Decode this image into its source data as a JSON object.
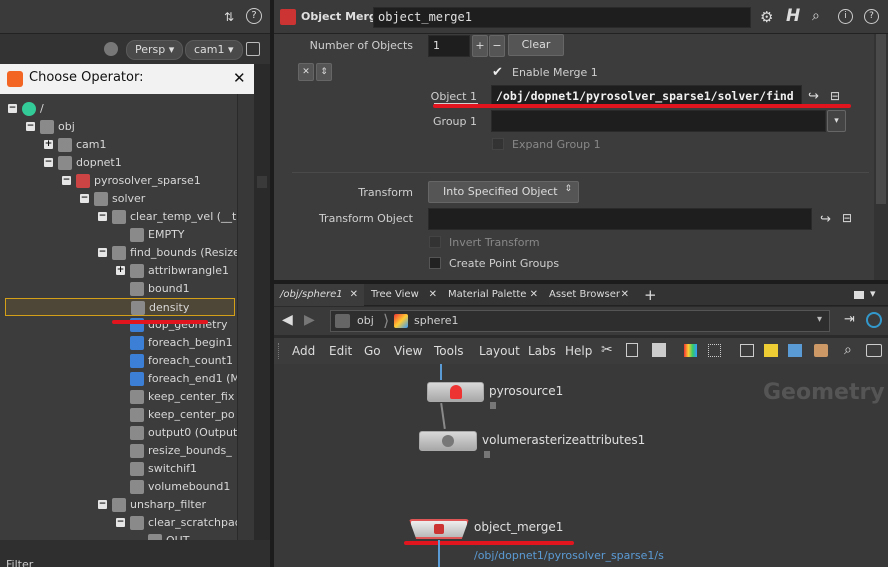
{
  "left_panel": {
    "viewport": {
      "persp_label": "Persp",
      "cam_label": "cam1"
    },
    "chooser_title": "Choose Operator:",
    "close_glyph": "✕",
    "filter_label": "Filter",
    "tree": [
      {
        "label": "/",
        "level": 0,
        "toggle": "−"
      },
      {
        "label": "obj",
        "level": 1,
        "toggle": "−"
      },
      {
        "label": "cam1",
        "level": 2,
        "toggle": "+"
      },
      {
        "label": "dopnet1",
        "level": 2,
        "toggle": "−"
      },
      {
        "label": "pyrosolver_sparse1",
        "level": 3,
        "toggle": "−"
      },
      {
        "label": "solver",
        "level": 4,
        "toggle": "−"
      },
      {
        "label": "clear_temp_vel (__t",
        "level": 5,
        "toggle": "−"
      },
      {
        "label": "EMPTY",
        "level": 6,
        "toggle": ""
      },
      {
        "label": "find_bounds (Resize",
        "level": 5,
        "toggle": "−"
      },
      {
        "label": "attribwrangle1",
        "level": 6,
        "toggle": "+"
      },
      {
        "label": "bound1",
        "level": 6,
        "toggle": ""
      },
      {
        "label": "density",
        "level": 6,
        "toggle": "",
        "selected": true
      },
      {
        "label": "dop_geometry",
        "level": 6,
        "toggle": ""
      },
      {
        "label": "foreach_begin1",
        "level": 6,
        "toggle": ""
      },
      {
        "label": "foreach_count1",
        "level": 6,
        "toggle": ""
      },
      {
        "label": "foreach_end1 (M",
        "level": 6,
        "toggle": ""
      },
      {
        "label": "keep_center_fix",
        "level": 6,
        "toggle": ""
      },
      {
        "label": "keep_center_po",
        "level": 6,
        "toggle": ""
      },
      {
        "label": "output0 (Output",
        "level": 6,
        "toggle": ""
      },
      {
        "label": "resize_bounds_",
        "level": 6,
        "toggle": ""
      },
      {
        "label": "switchif1",
        "level": 6,
        "toggle": ""
      },
      {
        "label": "volumebound1",
        "level": 6,
        "toggle": ""
      },
      {
        "label": "unsharp_filter",
        "level": 5,
        "toggle": "−"
      },
      {
        "label": "clear_scratchpad (t",
        "level": 6,
        "toggle": "−"
      },
      {
        "label": "OUT",
        "level": 7,
        "toggle": ""
      }
    ]
  },
  "param": {
    "node_type": "Object Merge",
    "node_name": "object_merge1",
    "num_objects_label": "Number of Objects",
    "num_objects_value": "1",
    "plus": "+",
    "minus": "−",
    "clear_label": "Clear",
    "enable_merge_label": "Enable Merge 1",
    "object1_label": "Object 1",
    "object1_value": "/obj/dopnet1/pyrosolver_sparse1/solver/find",
    "group1_label": "Group 1",
    "group1_value": "",
    "expand_group_label": "Expand Group 1",
    "transform_label": "Transform",
    "transform_value": "Into Specified Object",
    "transform_object_label": "Transform Object",
    "transform_object_value": "",
    "invert_transform_label": "Invert Transform",
    "create_point_groups_label": "Create Point Groups"
  },
  "tabs": [
    {
      "label": "/obj/sphere1",
      "closable": true
    },
    {
      "label": "Tree View",
      "closable": true
    },
    {
      "label": "Material Palette",
      "closable": true
    },
    {
      "label": "Asset Browser",
      "closable": true
    }
  ],
  "tab_add": "+",
  "path": {
    "segment1": "obj",
    "segment2": "sphere1"
  },
  "menus": [
    "Add",
    "Edit",
    "Go",
    "View",
    "Tools",
    "Layout",
    "Labs",
    "Help"
  ],
  "network": {
    "context_label": "Geometry",
    "nodes": [
      {
        "name": "pyrosource1"
      },
      {
        "name": "volumerasterizeattributes1"
      },
      {
        "name": "object_merge1",
        "subtitle": "/obj/dopnet1/pyrosolver_sparse1/s"
      }
    ]
  },
  "colors": {
    "accent_red": "#e0151e",
    "selection_border": "#d4a017",
    "path_blue": "#5b9bd5"
  }
}
